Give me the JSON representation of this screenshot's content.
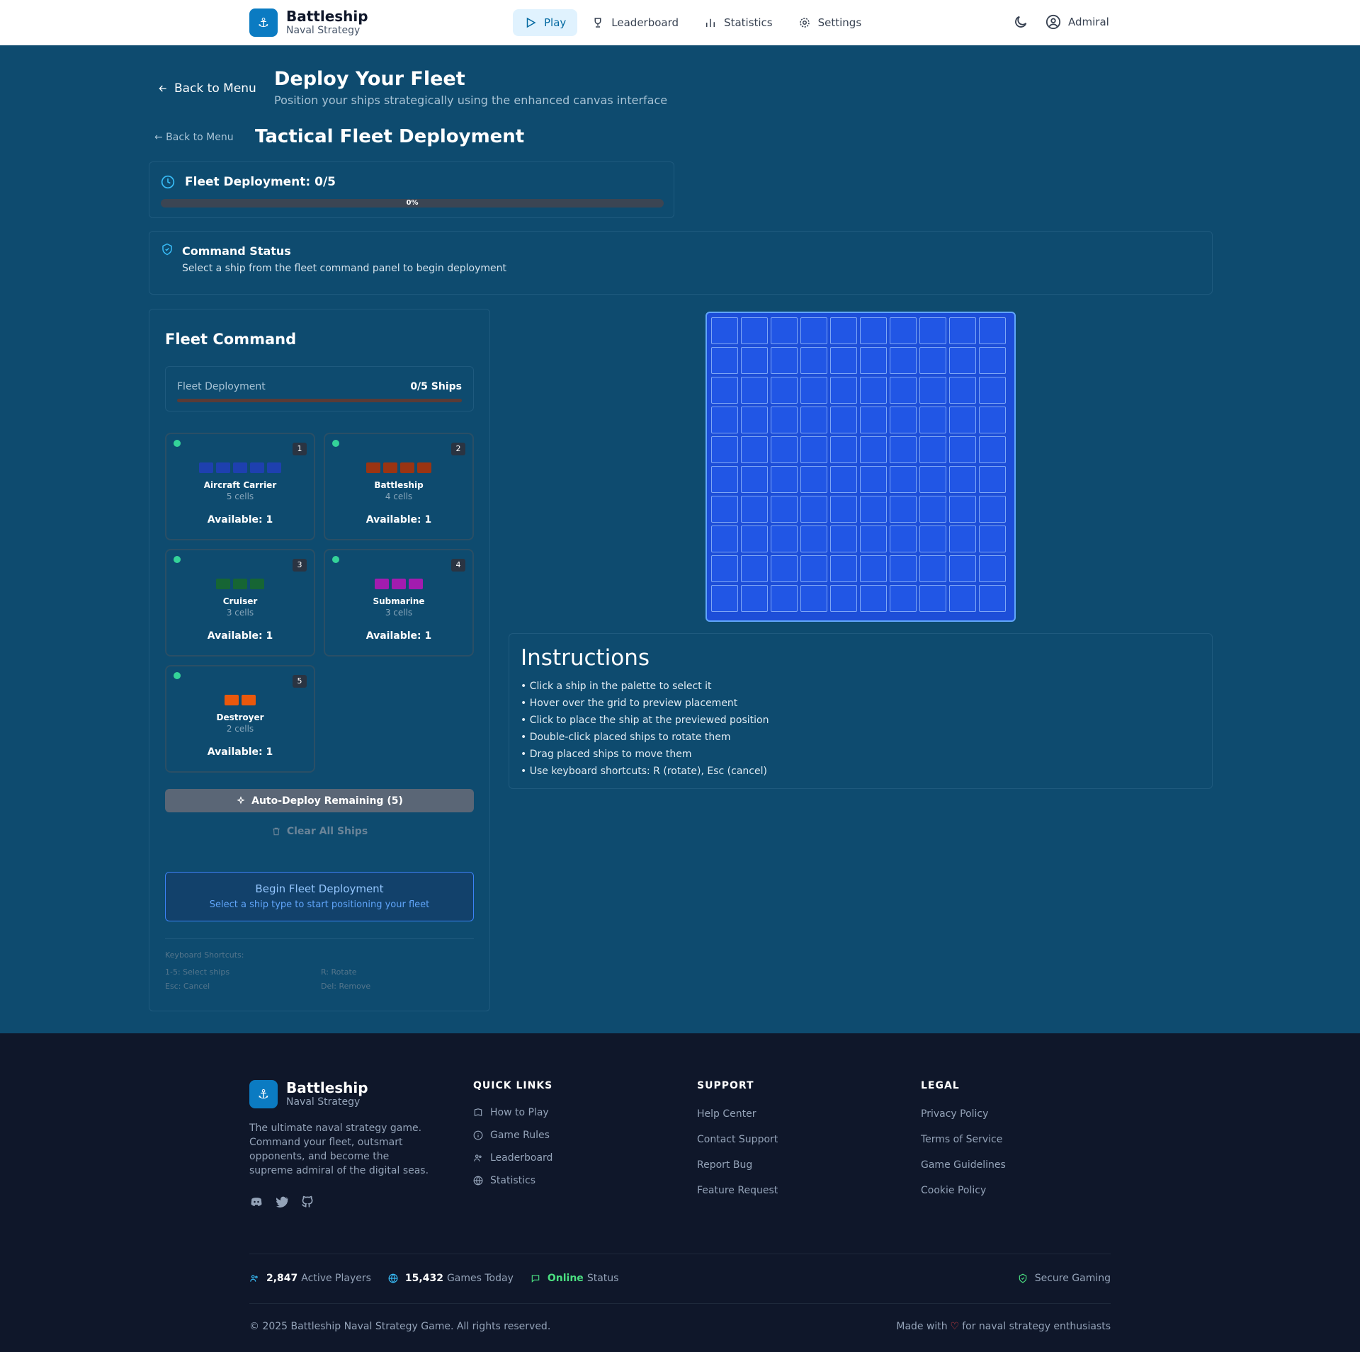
{
  "header": {
    "brand_title": "Battleship",
    "brand_sub": "Naval Strategy",
    "nav": [
      {
        "label": "Play",
        "icon": "play-icon"
      },
      {
        "label": "Leaderboard",
        "icon": "trophy-icon"
      },
      {
        "label": "Statistics",
        "icon": "bar-chart-icon"
      },
      {
        "label": "Settings",
        "icon": "gear-icon"
      }
    ],
    "user_label": "Admiral"
  },
  "page": {
    "back_label": "Back to Menu",
    "title": "Deploy Your Fleet",
    "subtitle": "Position your ships strategically using the enhanced canvas interface",
    "back_label_2": "← Back to Menu",
    "tactical_title": "Tactical Fleet Deployment"
  },
  "progress": {
    "label": "Fleet Deployment: 0/5",
    "percent_label": "0%",
    "fraction": 0
  },
  "command_status": {
    "title": "Command Status",
    "text": "Select a ship from the fleet command panel to begin deployment"
  },
  "fleet": {
    "title": "Fleet Command",
    "deployment_label": "Fleet Deployment",
    "deployment_count": "0/5 Ships",
    "ships": [
      {
        "name": "Aircraft Carrier",
        "size_label": "5 cells",
        "cells": 5,
        "key": "1",
        "available": "Available: 1",
        "color": "#1e40af"
      },
      {
        "name": "Battleship",
        "size_label": "4 cells",
        "cells": 4,
        "key": "2",
        "available": "Available: 1",
        "color": "#9a3412"
      },
      {
        "name": "Cruiser",
        "size_label": "3 cells",
        "cells": 3,
        "key": "3",
        "available": "Available: 1",
        "color": "#166534"
      },
      {
        "name": "Submarine",
        "size_label": "3 cells",
        "cells": 3,
        "key": "4",
        "available": "Available: 1",
        "color": "#a21caf"
      },
      {
        "name": "Destroyer",
        "size_label": "2 cells",
        "cells": 2,
        "key": "5",
        "available": "Available: 1",
        "color": "#ea580c"
      }
    ],
    "auto_deploy": "Auto-Deploy Remaining (5)",
    "clear_all": "Clear All Ships",
    "begin_title": "Begin Fleet Deployment",
    "begin_sub": "Select a ship type to start positioning your fleet",
    "shortcuts_title": "Keyboard Shortcuts:",
    "shortcuts": [
      "1-5: Select ships",
      "R: Rotate",
      "Esc: Cancel",
      "Del: Remove"
    ]
  },
  "board": {
    "rows": 10,
    "cols": 10
  },
  "instructions": {
    "title": "Instructions",
    "items": [
      "• Click a ship in the palette to select it",
      "• Hover over the grid to preview placement",
      "• Click to place the ship at the previewed position",
      "• Double-click placed ships to rotate them",
      "• Drag placed ships to move them",
      "• Use keyboard shortcuts: R (rotate), Esc (cancel)"
    ]
  },
  "footer": {
    "brand_title": "Battleship",
    "brand_sub": "Naval Strategy",
    "description": "The ultimate naval strategy game. Command your fleet, outsmart opponents, and become the supreme admiral of the digital seas.",
    "quick_links_title": "QUICK LINKS",
    "quick_links": [
      "How to Play",
      "Game Rules",
      "Leaderboard",
      "Statistics"
    ],
    "support_title": "SUPPORT",
    "support_links": [
      "Help Center",
      "Contact Support",
      "Report Bug",
      "Feature Request"
    ],
    "legal_title": "LEGAL",
    "legal_links": [
      "Privacy Policy",
      "Terms of Service",
      "Game Guidelines",
      "Cookie Policy"
    ],
    "stats": {
      "players_value": "2,847",
      "players_label": "Active Players",
      "games_value": "15,432",
      "games_label": "Games Today",
      "status_value": "Online",
      "status_label": "Status"
    },
    "secure": "Secure Gaming",
    "copyright": "© 2025 Battleship Naval Strategy Game. All rights reserved.",
    "made_prefix": "Made with",
    "made_suffix": "for naval strategy enthusiasts"
  }
}
